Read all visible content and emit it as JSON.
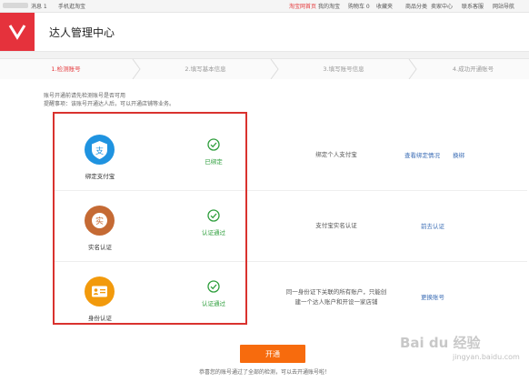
{
  "topbar": {
    "messages": "消息 1",
    "mobile": "手机逛淘宝",
    "home": "淘宝网首页",
    "my_taobao": "我的淘宝",
    "cart": "购物车 0",
    "favorites": "收藏夹",
    "categories": "商品分类",
    "seller": "卖家中心",
    "service": "联系客服",
    "sitemap": "网站导航"
  },
  "header": {
    "title": "达人管理中心"
  },
  "steps": [
    {
      "label": "1.检测账号"
    },
    {
      "label": "2.填写基本信息"
    },
    {
      "label": "3.填写账号信息"
    },
    {
      "label": "4.成功开通账号"
    }
  ],
  "notes": {
    "line1": "账号开通前请先检测账号是否可用",
    "line2": "提醒事项：该账号开通达人后，可以开通店铺等业务。"
  },
  "rows": [
    {
      "label": "绑定支付宝",
      "status": "已绑定",
      "desc": "绑定个人支付宝",
      "action1": "查看绑定情况",
      "action2": "换绑",
      "color": "#1f93e0"
    },
    {
      "label": "实名认证",
      "status": "认证通过",
      "desc": "支付宝实名认证",
      "action1": "前去认证",
      "color": "#c56a34"
    },
    {
      "label": "身份认证",
      "status": "认证通过",
      "desc_line1": "同一身份证下关联的所有账户，只能创",
      "desc_line2": "建一个达人账户和开设一家店铺",
      "action1": "更换账号",
      "color": "#f29a0c"
    }
  ],
  "icon_glyphs": {
    "row2": "实"
  },
  "button": {
    "label": "开通"
  },
  "footer": {
    "text": "恭喜您的账号通过了全部的检测，可以去开通账号啦！"
  },
  "watermark": {
    "text1": "Bai du 经验",
    "text2": "jingyan.baidu.com"
  }
}
